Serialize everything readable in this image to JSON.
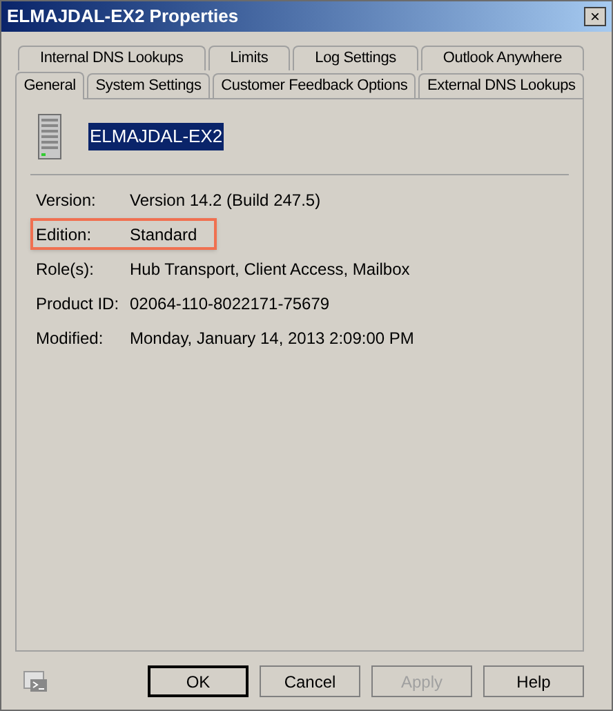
{
  "window": {
    "title": "ELMAJDAL-EX2 Properties",
    "close": "×"
  },
  "tab_rows": [
    [
      {
        "label": "Internal DNS Lookups",
        "selected": false
      },
      {
        "label": "Limits",
        "selected": false
      },
      {
        "label": "Log Settings",
        "selected": false
      },
      {
        "label": "Outlook Anywhere",
        "selected": false
      }
    ],
    [
      {
        "label": "General",
        "selected": true
      },
      {
        "label": "System Settings",
        "selected": false
      },
      {
        "label": "Customer Feedback Options",
        "selected": false
      },
      {
        "label": "External DNS Lookups",
        "selected": false
      }
    ]
  ],
  "server_name": "ELMAJDAL-EX2",
  "properties": [
    {
      "label": "Version:",
      "value": "Version 14.2 (Build 247.5)",
      "highlighted": false
    },
    {
      "label": "Edition:",
      "value": "Standard",
      "highlighted": true
    },
    {
      "label": "Role(s):",
      "value": "Hub Transport, Client Access, Mailbox",
      "highlighted": false
    },
    {
      "label": "Product ID:",
      "value": "02064-110-8022171-75679",
      "highlighted": false
    },
    {
      "label": "Modified:",
      "value": "Monday, January 14, 2013 2:09:00 PM",
      "highlighted": false
    }
  ],
  "buttons": [
    {
      "label": "OK",
      "default": true,
      "disabled": false
    },
    {
      "label": "Cancel",
      "default": false,
      "disabled": false
    },
    {
      "label": "Apply",
      "default": false,
      "disabled": true
    },
    {
      "label": "Help",
      "default": false,
      "disabled": false
    }
  ]
}
